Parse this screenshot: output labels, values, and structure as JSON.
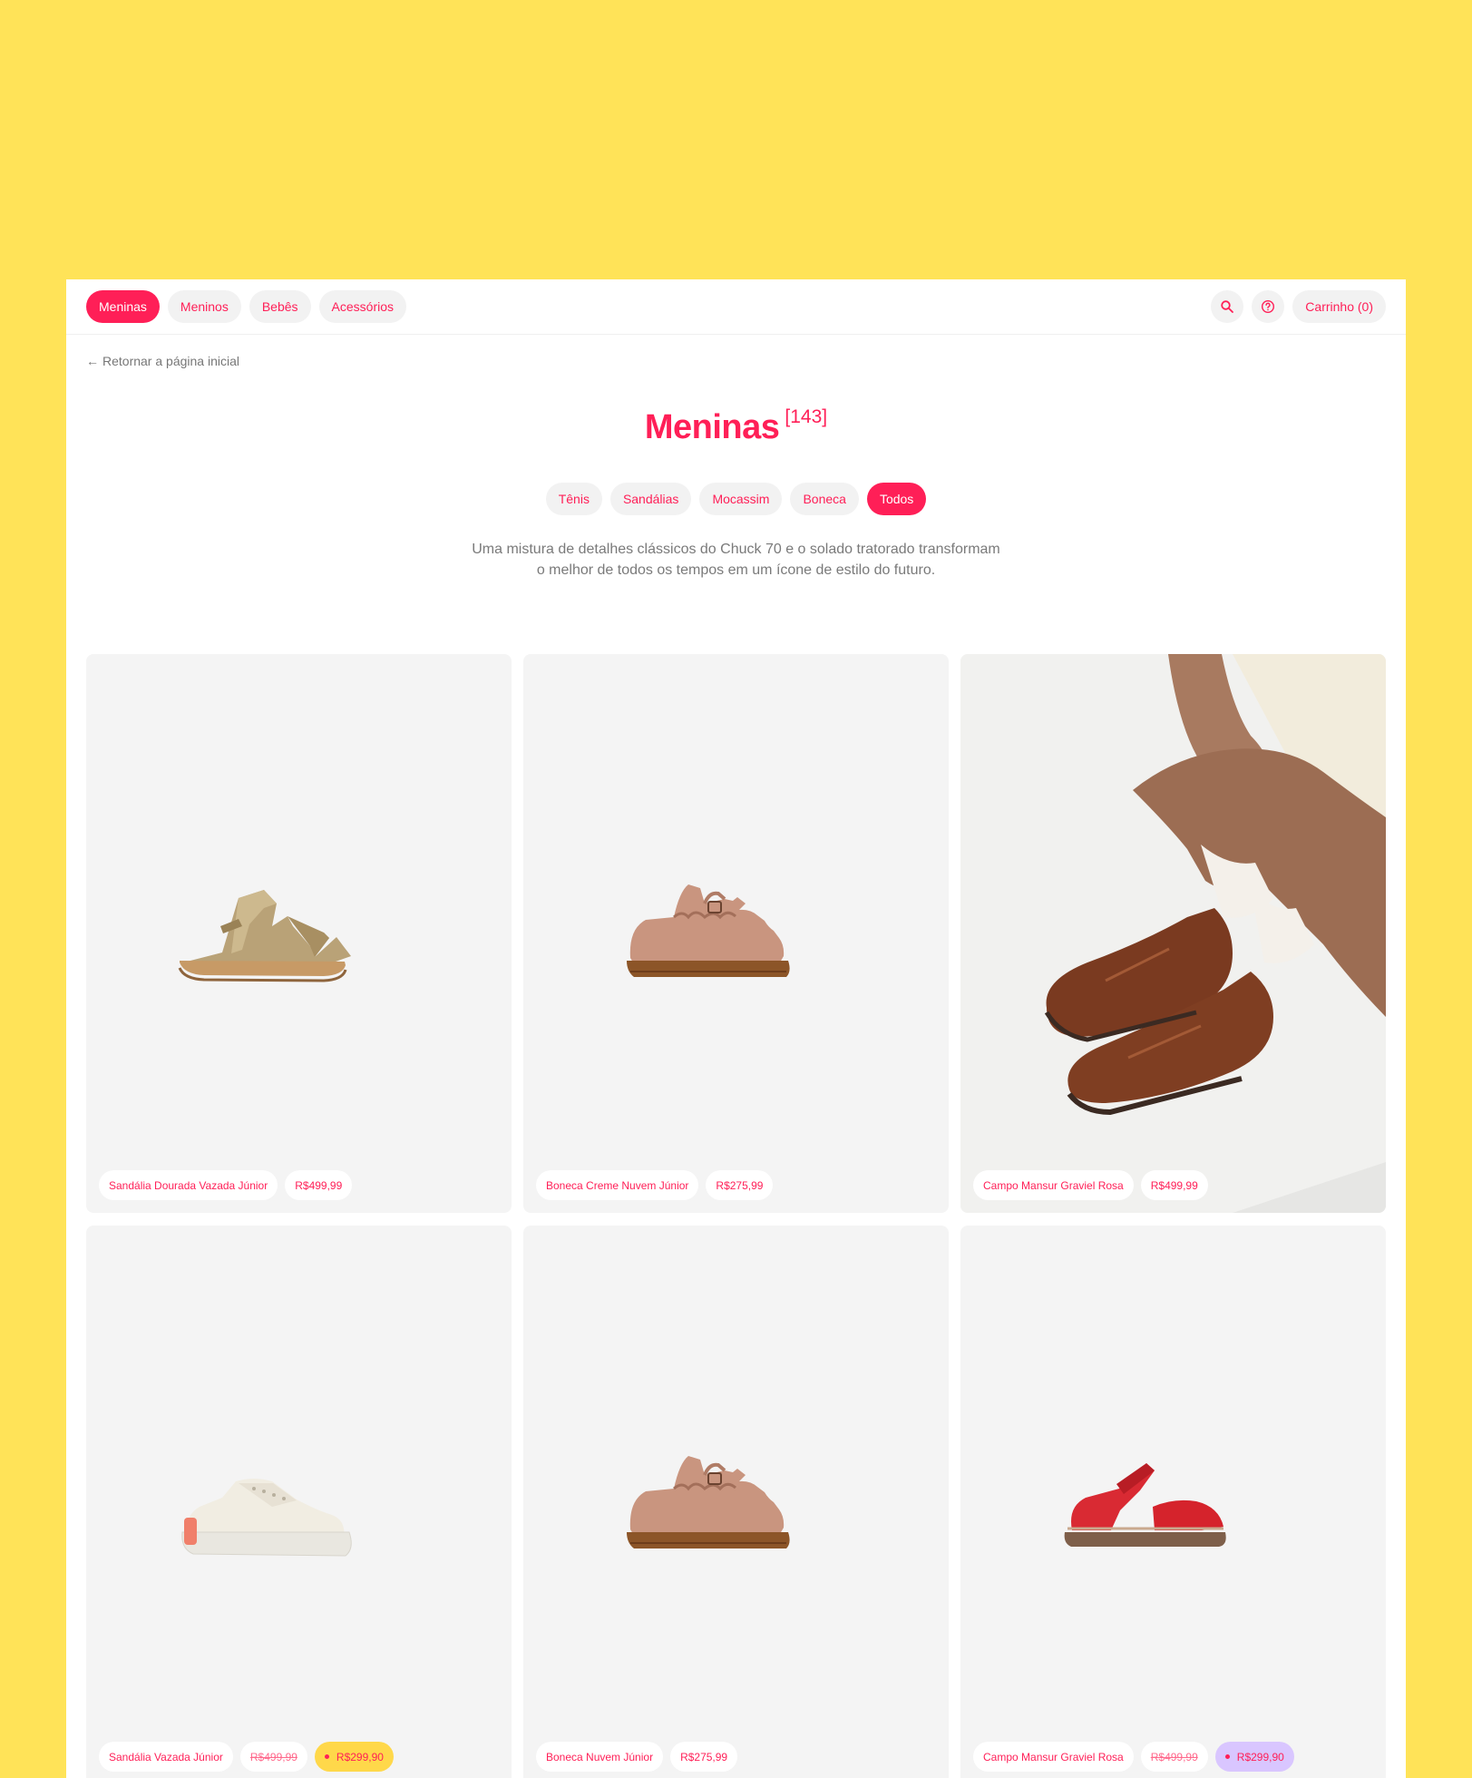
{
  "nav": {
    "categories": [
      "Meninas",
      "Meninos",
      "Bebês",
      "Acessórios"
    ],
    "active_category": "Meninas",
    "cart_label": "Carrinho (0)",
    "icons": [
      "search-icon",
      "help-icon"
    ]
  },
  "back_link": "Retornar a página inicial",
  "page": {
    "title": "Meninas",
    "count": "[143]",
    "subcategories": [
      "Tênis",
      "Sandálias",
      "Mocassim",
      "Boneca",
      "Todos"
    ],
    "active_subcategory": "Todos",
    "description_line1": "Uma mistura de detalhes clássicos do Chuck 70 e o solado tratorado transformam",
    "description_line2": "o melhor de todos os tempos em um ícone de estilo do futuro."
  },
  "products": [
    {
      "name": "Sandália Dourada Vazada Júnior",
      "price": "R$499,99"
    },
    {
      "name": "Boneca Creme Nuvem Júnior",
      "price": "R$275,99"
    },
    {
      "name": "Campo Mansur Graviel Rosa",
      "price": "R$499,99"
    },
    {
      "name": "Sandália Vazada Júnior",
      "old_price": "R$499,99",
      "sale_price": "R$299,90"
    },
    {
      "name": "Boneca Nuvem Júnior",
      "price": "R$275,99"
    },
    {
      "name": "Campo Mansur Graviel Rosa",
      "old_price": "R$499,99",
      "sale_price": "R$299,90"
    }
  ],
  "colors": {
    "background": "#FFE358",
    "brand": "#FF1F57",
    "card": "#F4F4F4",
    "sale_yellow": "#FFD84A",
    "sale_purple": "#D9C6FF"
  }
}
